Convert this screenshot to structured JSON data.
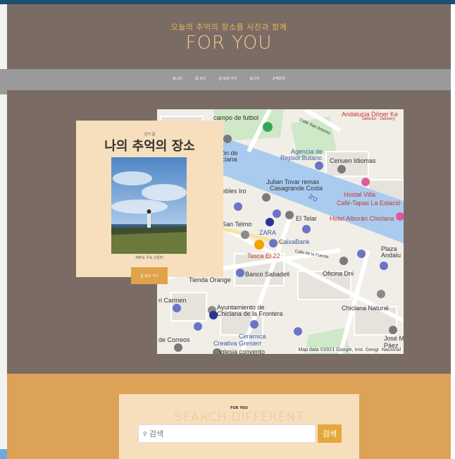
{
  "header": {
    "subtitle": "오늘의 추억의 장소를 사진과 함께",
    "brand": "FOR YOU"
  },
  "nav": {
    "items": [
      {
        "label": "로그인"
      },
      {
        "label": "글 쓰기"
      },
      {
        "label": "글 보러 가기"
      },
      {
        "label": "로그인"
      },
      {
        "label": "고객문의"
      }
    ]
  },
  "card": {
    "badge": "인기 글",
    "title": "나의 추억의 장소",
    "caption": "제주도 우도 1일차!",
    "button": "글 보러 가기"
  },
  "map": {
    "labels": [
      {
        "text": "Andalucia Döner Ke",
        "cls": "red"
      },
      {
        "text": "Takeout · Delivery",
        "cls": "red"
      },
      {
        "text": "campo de futbol",
        "cls": ""
      },
      {
        "text": "Calle San Antonio",
        "cls": ""
      },
      {
        "text": "Agencia de",
        "cls": "blue"
      },
      {
        "text": "Repsol Butano",
        "cls": "blue"
      },
      {
        "text": "Cenuen Idiomas",
        "cls": ""
      },
      {
        "text": "ón de",
        "cls": ""
      },
      {
        "text": "ciana",
        "cls": ""
      },
      {
        "text": "Julian Tovar remax",
        "cls": ""
      },
      {
        "text": "Casagrande Costa",
        "cls": ""
      },
      {
        "text": "ebles Iro",
        "cls": ""
      },
      {
        "text": "Iro",
        "cls": "river"
      },
      {
        "text": "Hostal Villa",
        "cls": "red"
      },
      {
        "text": "Café-Tapas La Estació",
        "cls": "red"
      },
      {
        "text": "El Telar",
        "cls": ""
      },
      {
        "text": "Hotel Alborán Chiclana",
        "cls": "red"
      },
      {
        "text": "San Telmo",
        "cls": ""
      },
      {
        "text": "ZARA",
        "cls": "blue"
      },
      {
        "text": "CaixaBank",
        "cls": "blue"
      },
      {
        "text": "Tasca El 22",
        "cls": "red"
      },
      {
        "text": "Calle de la Fuente",
        "cls": ""
      },
      {
        "text": "Plaza",
        "cls": ""
      },
      {
        "text": "Andalu",
        "cls": ""
      },
      {
        "text": "Oficina Dni",
        "cls": ""
      },
      {
        "text": "Tienda Orange",
        "cls": ""
      },
      {
        "text": "Banco Sabadell",
        "cls": ""
      },
      {
        "text": "ri Carmen",
        "cls": ""
      },
      {
        "text": "Ayuntamiento de",
        "cls": ""
      },
      {
        "text": "Chiclana de la Frontera",
        "cls": ""
      },
      {
        "text": "Chiclana Natural",
        "cls": ""
      },
      {
        "text": "Cerámica",
        "cls": "blue"
      },
      {
        "text": "Creativa Gresierr",
        "cls": "blue"
      },
      {
        "text": "de Correos",
        "cls": ""
      },
      {
        "text": "Iglesia convento",
        "cls": ""
      },
      {
        "text": "José M",
        "cls": ""
      },
      {
        "text": "Páez",
        "cls": ""
      }
    ],
    "attribution": "Map data ©2021 Google, Inst. Geogr. Nacional"
  },
  "search": {
    "small_label": "FOR YOU",
    "big_label": "SEARCH DIFFERENT",
    "placeholder": "검색",
    "button": "검색",
    "icon": "search-icon"
  },
  "colors": {
    "header_bg": "#7b6b65",
    "nav_bg": "#9a9a9a",
    "accent": "#e3a93c",
    "card_bg": "#f7dfbd",
    "search_section_bg": "#dca257"
  }
}
